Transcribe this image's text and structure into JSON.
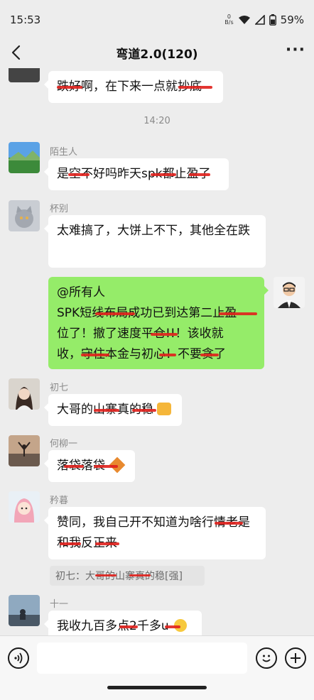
{
  "status_bar": {
    "time": "15:53",
    "data_rate_value": "0",
    "data_rate_unit": "B/s",
    "battery": "59%"
  },
  "nav": {
    "title": "弯道2.0(120)",
    "more_label": "···"
  },
  "chat": {
    "messages": [
      {
        "text": "跌好啊，在下来一点就抄底"
      },
      {
        "timestamp": "14:20"
      },
      {
        "sender": "陌生人",
        "text": "是空不好吗昨天spk都止盈了"
      },
      {
        "sender": "杯别",
        "text": "太难搞了，大饼上不下，其他全在跌"
      },
      {
        "sender": "",
        "lines": [
          "@所有人",
          "SPK短线布局成功已到达第二止盈",
          "位了！撤了速度平仓!!！该收就",
          "收，守住本金与初心！不要贪了"
        ]
      },
      {
        "sender": "初七",
        "text": "大哥的山寨真的稳"
      },
      {
        "sender": "何柳一",
        "text": "落袋落袋"
      },
      {
        "sender": "矜暮",
        "text": "赞同，我自己开不知道为啥行情老是和我反正来"
      },
      {
        "quote": "初七：大哥的山寨真的稳[强]"
      },
      {
        "sender": "十一",
        "text": "我收九百多点2千多u"
      }
    ]
  },
  "input_bar": {
    "voice_icon": "voice-icon",
    "emoji_icon": "emoji-icon",
    "plus_icon": "plus-icon"
  }
}
